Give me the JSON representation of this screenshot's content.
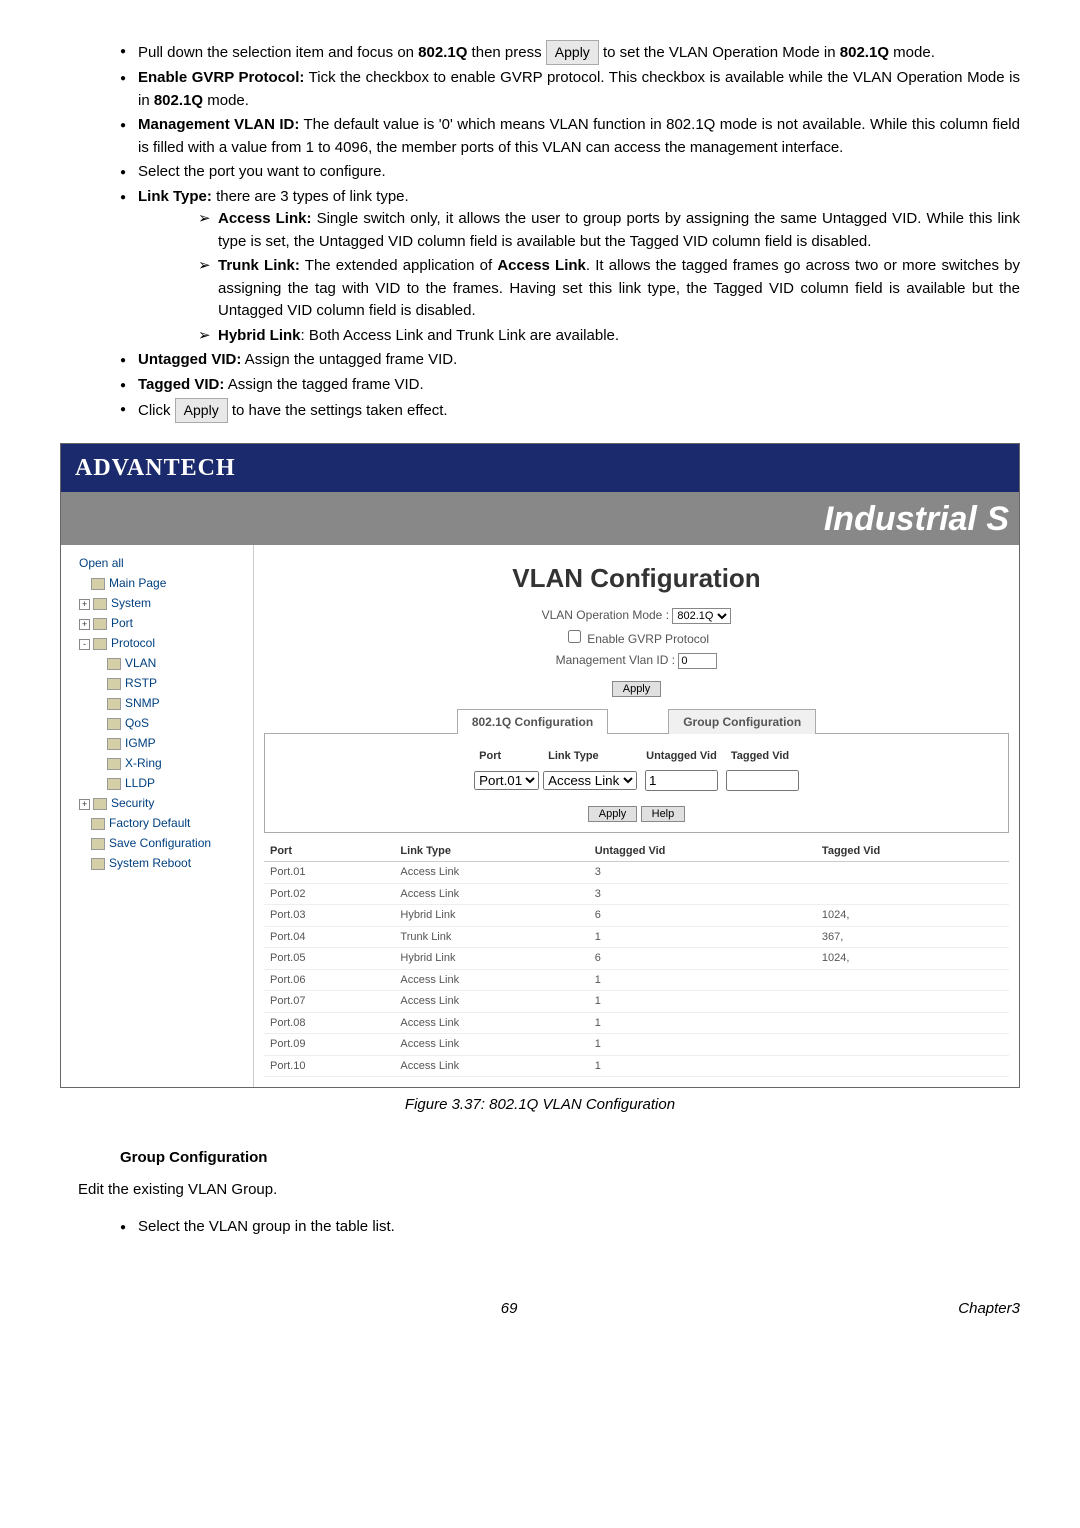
{
  "bullets": {
    "b1_a": "Pull down the selection item and focus on ",
    "b1_bold1": "802.1Q",
    "b1_b": " then press ",
    "b1_btn": "Apply",
    "b1_c": " to set the VLAN Operation Mode in ",
    "b1_bold2": "802.1Q",
    "b1_d": " mode.",
    "b2_bold": "Enable GVRP Protocol:",
    "b2_text": " Tick the checkbox to enable GVRP protocol. This checkbox is available while the VLAN Operation Mode is in ",
    "b2_bold2": "802.1Q",
    "b2_text2": " mode.",
    "b3_bold": "Management VLAN ID:",
    "b3_text": " The default value is '0' which means VLAN function in 802.1Q mode is not available. While this column field is filled with a value from 1 to 4096, the member ports of this VLAN can access the management interface.",
    "b4": "Select the port you want to configure.",
    "b5_bold": "Link Type:",
    "b5_text": " there are 3 types of link type.",
    "s1_bold": "Access Link:",
    "s1_text": " Single switch only, it allows the user to group ports by assigning the same Untagged VID. While this link type is set, the Untagged VID column field is available but the Tagged VID column field is disabled.",
    "s2_bold": "Trunk Link:",
    "s2_text1": " The extended application of ",
    "s2_bold2": "Access Link",
    "s2_text2": ". It allows the tagged frames go across two or more switches by assigning the tag with VID to the frames. Having set this link type, the Tagged VID column field is available but the Untagged VID column field is disabled.",
    "s3_bold": "Hybrid Link",
    "s3_text": ": Both Access Link and Trunk Link are available.",
    "b6_bold": "Untagged VID:",
    "b6_text": " Assign the untagged frame VID.",
    "b7_bold": "Tagged VID:",
    "b7_text": " Assign the tagged frame VID.",
    "b8_a": "Click ",
    "b8_btn": "Apply",
    "b8_b": " to have the settings taken effect."
  },
  "brand": "ADVANTECH",
  "product": "Industrial S",
  "sidebar": {
    "open": "Open all",
    "items": [
      "Main Page",
      "System",
      "Port",
      "Protocol",
      "VLAN",
      "RSTP",
      "SNMP",
      "QoS",
      "IGMP",
      "X-Ring",
      "LLDP",
      "Security",
      "Factory Default",
      "Save Configuration",
      "System Reboot"
    ]
  },
  "panel": {
    "title": "VLAN Configuration",
    "mode_label": "VLAN Operation Mode :",
    "mode_value": "802.1Q",
    "gvrp": "Enable GVRP Protocol",
    "mgmt": "Management Vlan ID :",
    "mgmt_val": "0",
    "apply": "Apply",
    "help": "Help",
    "tab1": "802.1Q Configuration",
    "tab2": "Group Configuration",
    "hdr_port": "Port",
    "hdr_link": "Link Type",
    "hdr_uvid": "Untagged Vid",
    "hdr_tvid": "Tagged Vid",
    "port_sel": "Port.01",
    "link_sel": "Access Link",
    "uvid_val": "1",
    "rows": [
      {
        "p": "Port.01",
        "l": "Access Link",
        "u": "3",
        "t": ""
      },
      {
        "p": "Port.02",
        "l": "Access Link",
        "u": "3",
        "t": ""
      },
      {
        "p": "Port.03",
        "l": "Hybrid Link",
        "u": "6",
        "t": "1024,"
      },
      {
        "p": "Port.04",
        "l": "Trunk Link",
        "u": "1",
        "t": "367,"
      },
      {
        "p": "Port.05",
        "l": "Hybrid Link",
        "u": "6",
        "t": "1024,"
      },
      {
        "p": "Port.06",
        "l": "Access Link",
        "u": "1",
        "t": ""
      },
      {
        "p": "Port.07",
        "l": "Access Link",
        "u": "1",
        "t": ""
      },
      {
        "p": "Port.08",
        "l": "Access Link",
        "u": "1",
        "t": ""
      },
      {
        "p": "Port.09",
        "l": "Access Link",
        "u": "1",
        "t": ""
      },
      {
        "p": "Port.10",
        "l": "Access Link",
        "u": "1",
        "t": ""
      }
    ]
  },
  "caption": "Figure 3.37: 802.1Q VLAN Configuration",
  "group_head": "Group Configuration",
  "group_text": "Edit the existing VLAN Group.",
  "group_b1": "Select the VLAN group in the table list.",
  "footer_page": "69",
  "footer_chap": "Chapter3"
}
